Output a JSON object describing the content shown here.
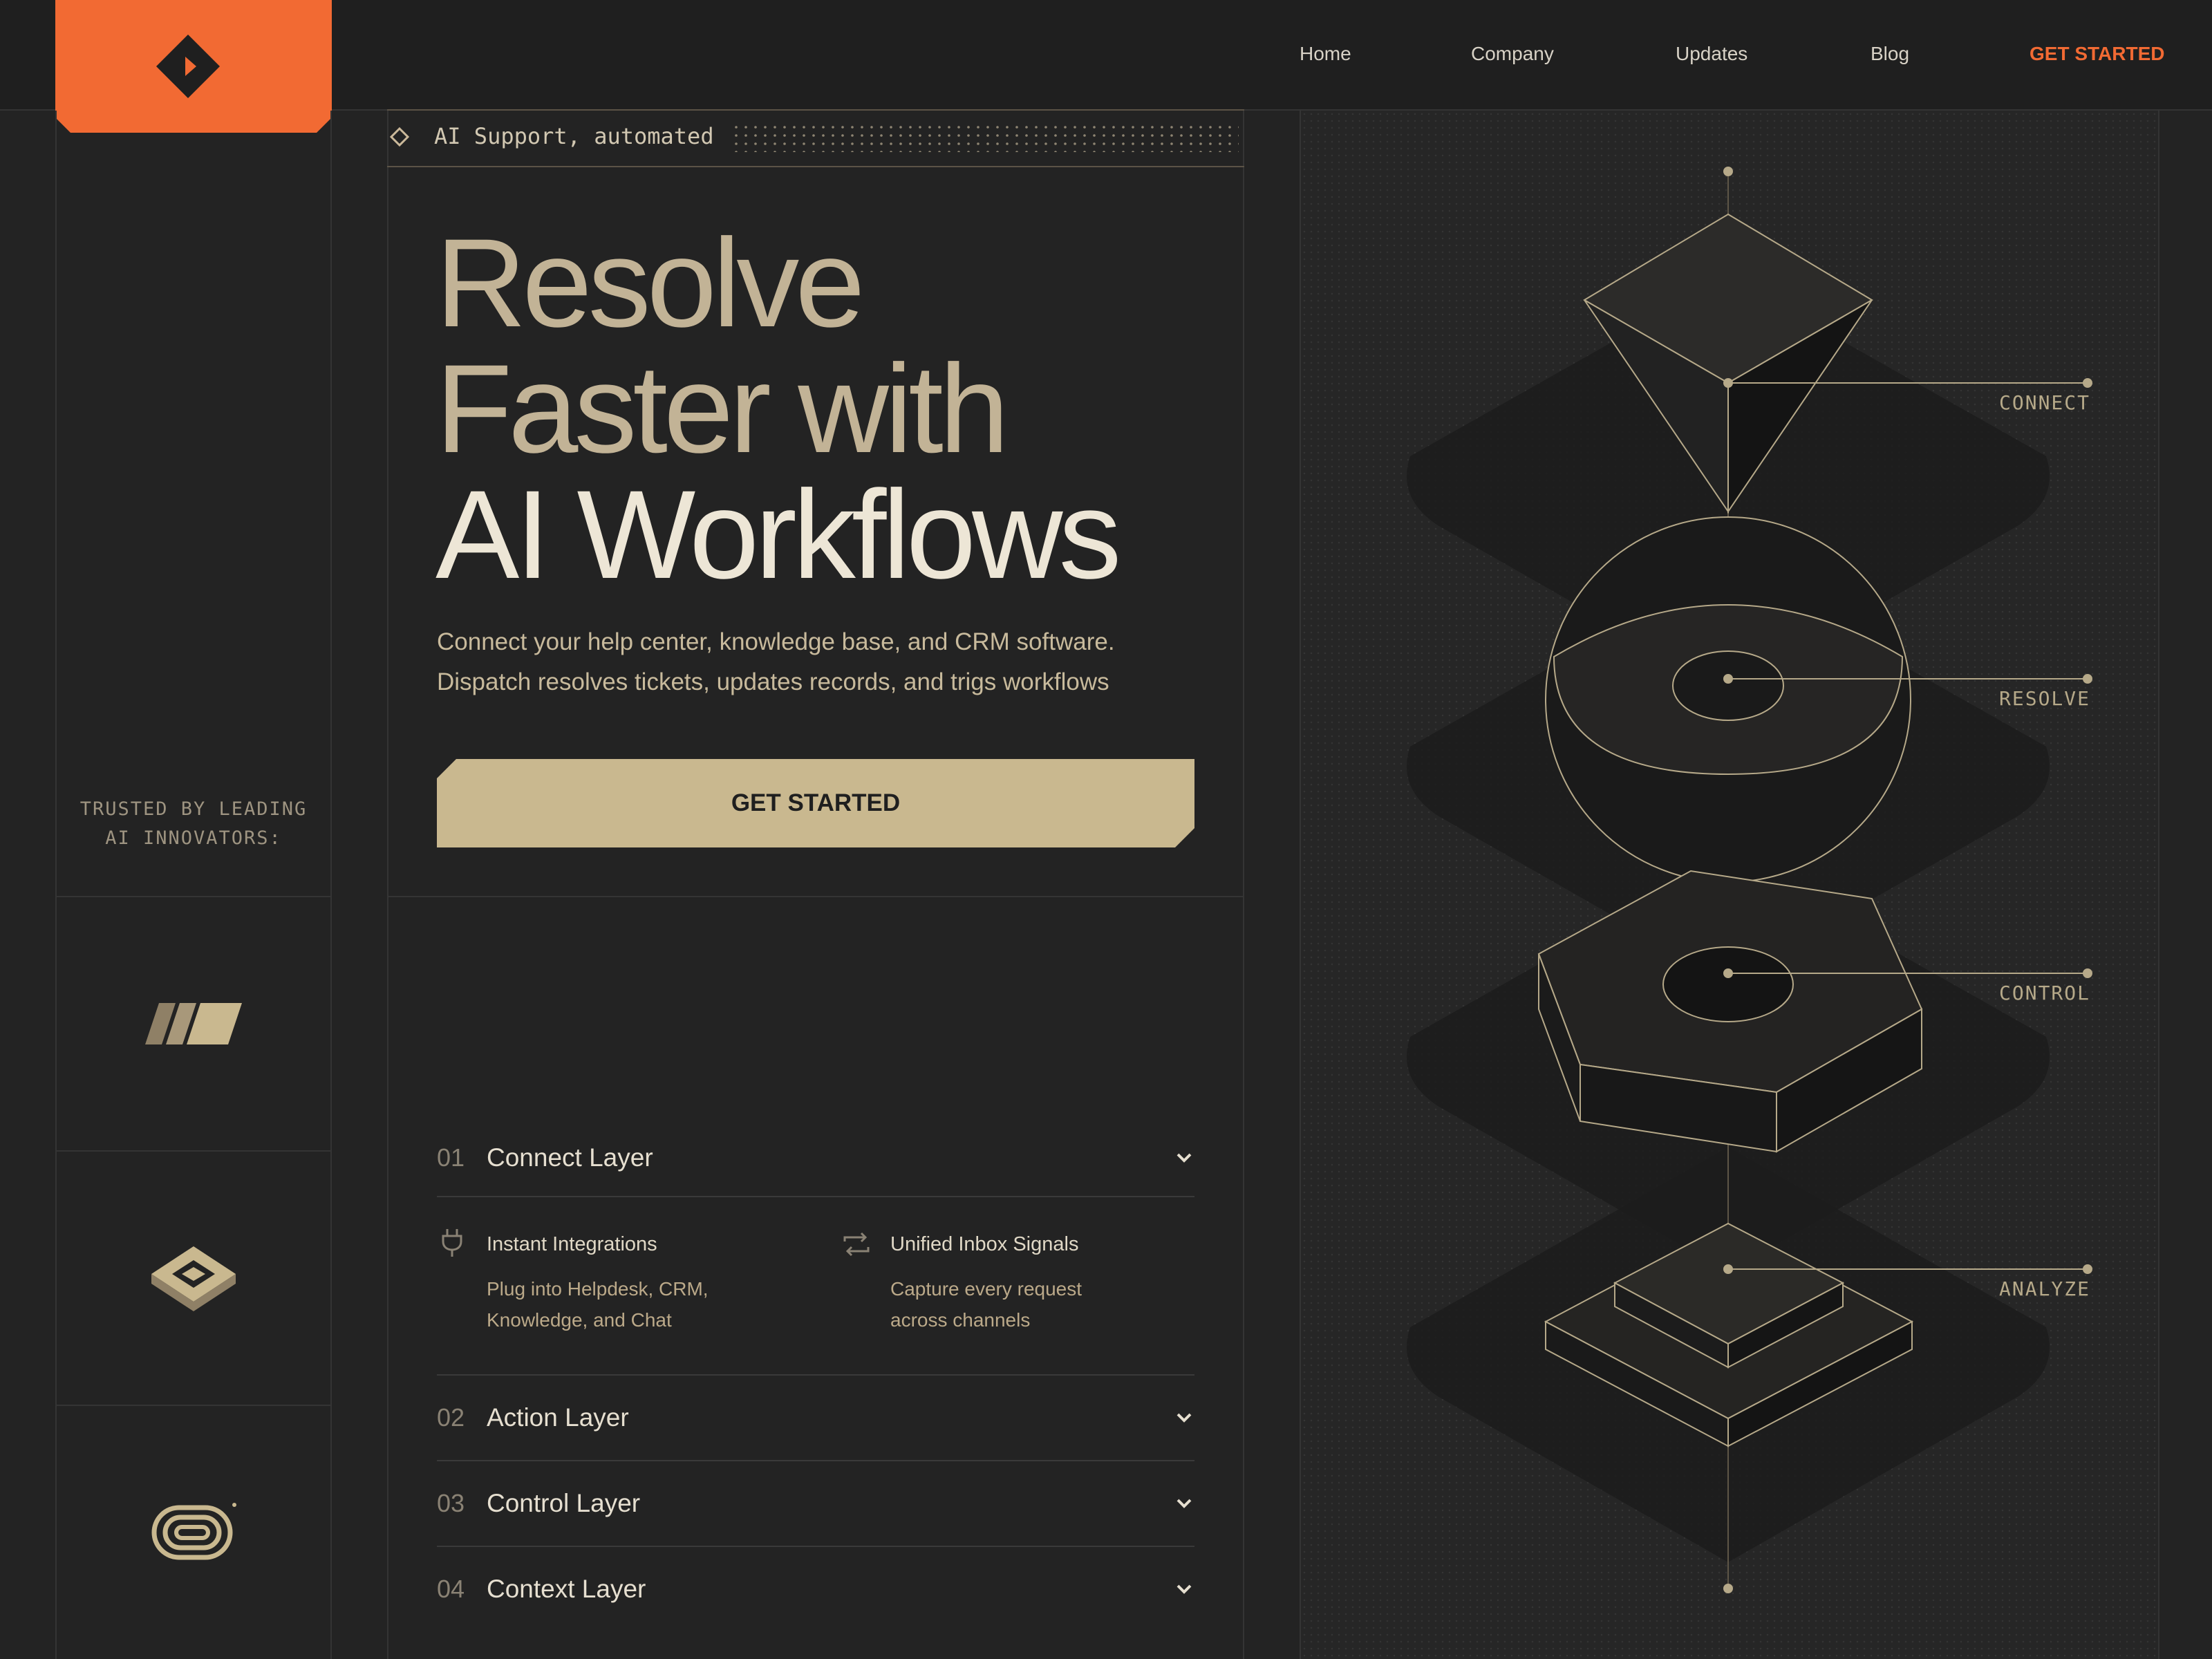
{
  "nav": {
    "items": [
      "Home",
      "Company",
      "Updates",
      "Blog"
    ],
    "cta": "GET STARTED"
  },
  "hero": {
    "tagline": "AI Support, automated",
    "headline": [
      "Resolve",
      "Faster with",
      "AI Workflows"
    ],
    "subtext": [
      "Connect your help center, knowledge base, and CRM software.",
      "Dispatch resolves tickets, updates records, and trigs workflows"
    ],
    "cta": "GET STARTED"
  },
  "trusted": {
    "label": [
      "TRUSTED BY LEADING",
      "AI INNOVATORS:"
    ]
  },
  "accordion": [
    {
      "num": "01",
      "title": "Connect Layer",
      "expanded": true,
      "features": [
        {
          "icon": "plug-icon",
          "title": "Instant Integrations",
          "desc": [
            "Plug into Helpdesk, CRM,",
            "Knowledge, and Chat"
          ]
        },
        {
          "icon": "sync-icon",
          "title": "Unified Inbox Signals",
          "desc": [
            "Capture every request",
            "across channels"
          ]
        }
      ]
    },
    {
      "num": "02",
      "title": "Action Layer",
      "expanded": false
    },
    {
      "num": "03",
      "title": "Control Layer",
      "expanded": false
    },
    {
      "num": "04",
      "title": "Context Layer",
      "expanded": false
    }
  ],
  "illustration": {
    "labels": [
      "CONNECT",
      "RESOLVE",
      "CONTROL",
      "ANALYZE"
    ]
  },
  "colors": {
    "background": "#232323",
    "accent": "#f26a33",
    "beige": "#c9b88f",
    "text_light": "#ede6d6"
  }
}
